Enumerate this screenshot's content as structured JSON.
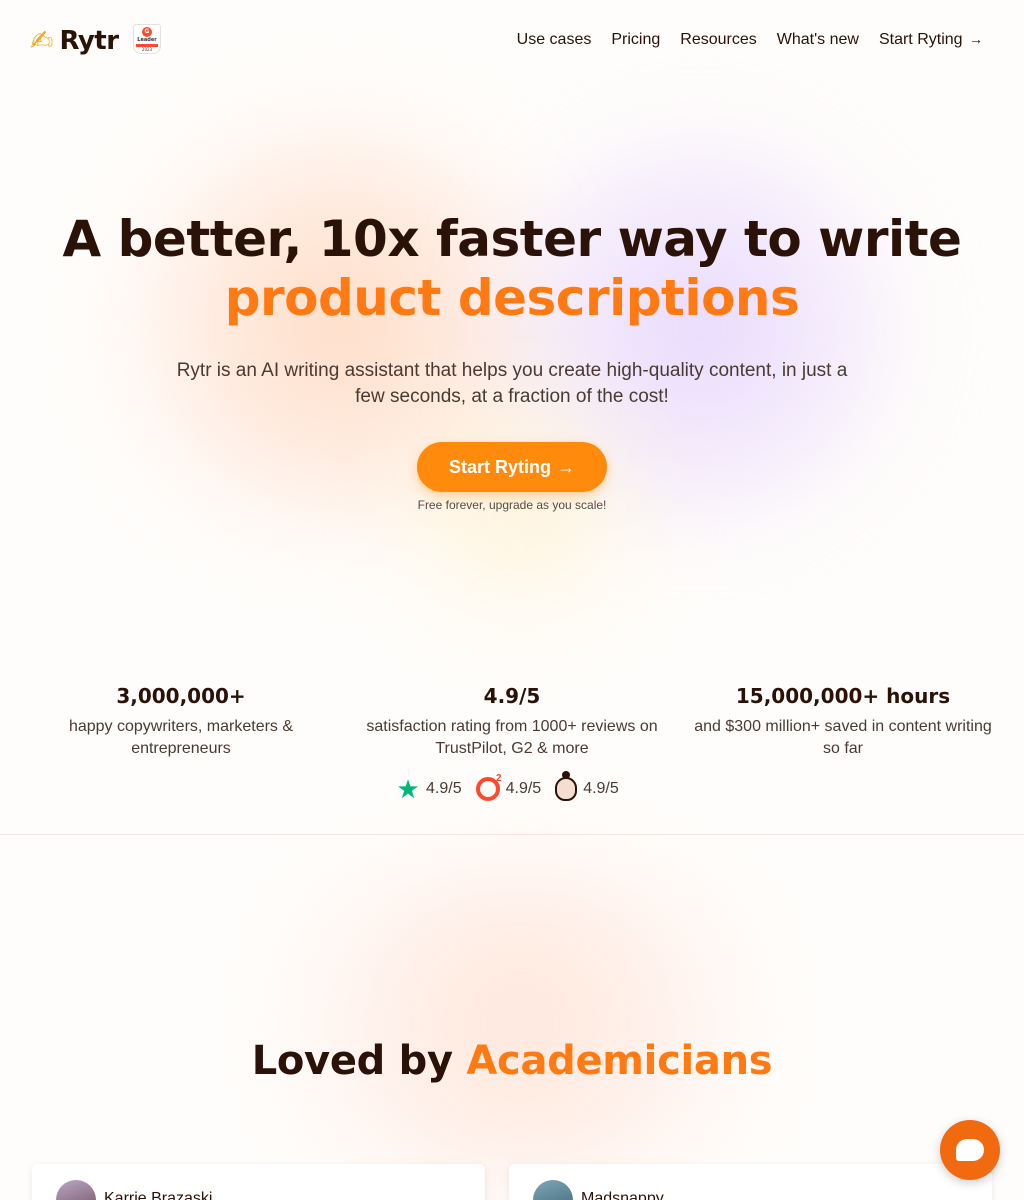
{
  "header": {
    "logo_text": "Rytr",
    "logo_icon": "writing-hand-emoji",
    "badge": {
      "label": "Leader",
      "year": "2023",
      "icon": "g2-badge"
    },
    "nav": [
      {
        "label": "Use cases"
      },
      {
        "label": "Pricing"
      },
      {
        "label": "Resources"
      },
      {
        "label": "What's new"
      },
      {
        "label": "Start Ryting",
        "icon": "arrow-right-icon"
      }
    ]
  },
  "hero": {
    "title_line1": "A better, 10x faster way to write",
    "title_accent": "product descriptions",
    "subtitle": "Rytr is an AI writing assistant that helps you create high-quality content, in just a few seconds, at a fraction of the cost!",
    "cta_label": "Start Ryting",
    "cta_arrow": "→",
    "cta_note": "Free forever, upgrade as you scale!"
  },
  "stats": [
    {
      "value": "3,000,000+",
      "desc": "happy copywriters, marketers & entrepreneurs"
    },
    {
      "value": "4.9/5",
      "desc": "satisfaction rating from 1000+ reviews on TrustPilot, G2 & more"
    },
    {
      "value": "15,000,000+ hours",
      "desc": "and $300 million+ saved in content writing so far"
    }
  ],
  "ratings": [
    {
      "source_icon": "trustpilot-star-icon",
      "score": "4.9/5"
    },
    {
      "source_icon": "g2-icon",
      "score": "4.9/5"
    },
    {
      "source_icon": "capterra-icon",
      "score": "4.9/5"
    }
  ],
  "loved": {
    "prefix": "Loved by",
    "accent": "Academicians"
  },
  "testimonials": [
    {
      "name": "Karrie Brazaski"
    },
    {
      "name": "Madsnappy"
    }
  ],
  "chat": {
    "icon": "chat-bubble-icon"
  },
  "colors": {
    "accent": "#ff7a13",
    "cta": "#ff8a0b",
    "text": "#2a1208",
    "chat": "#f26a0f"
  }
}
